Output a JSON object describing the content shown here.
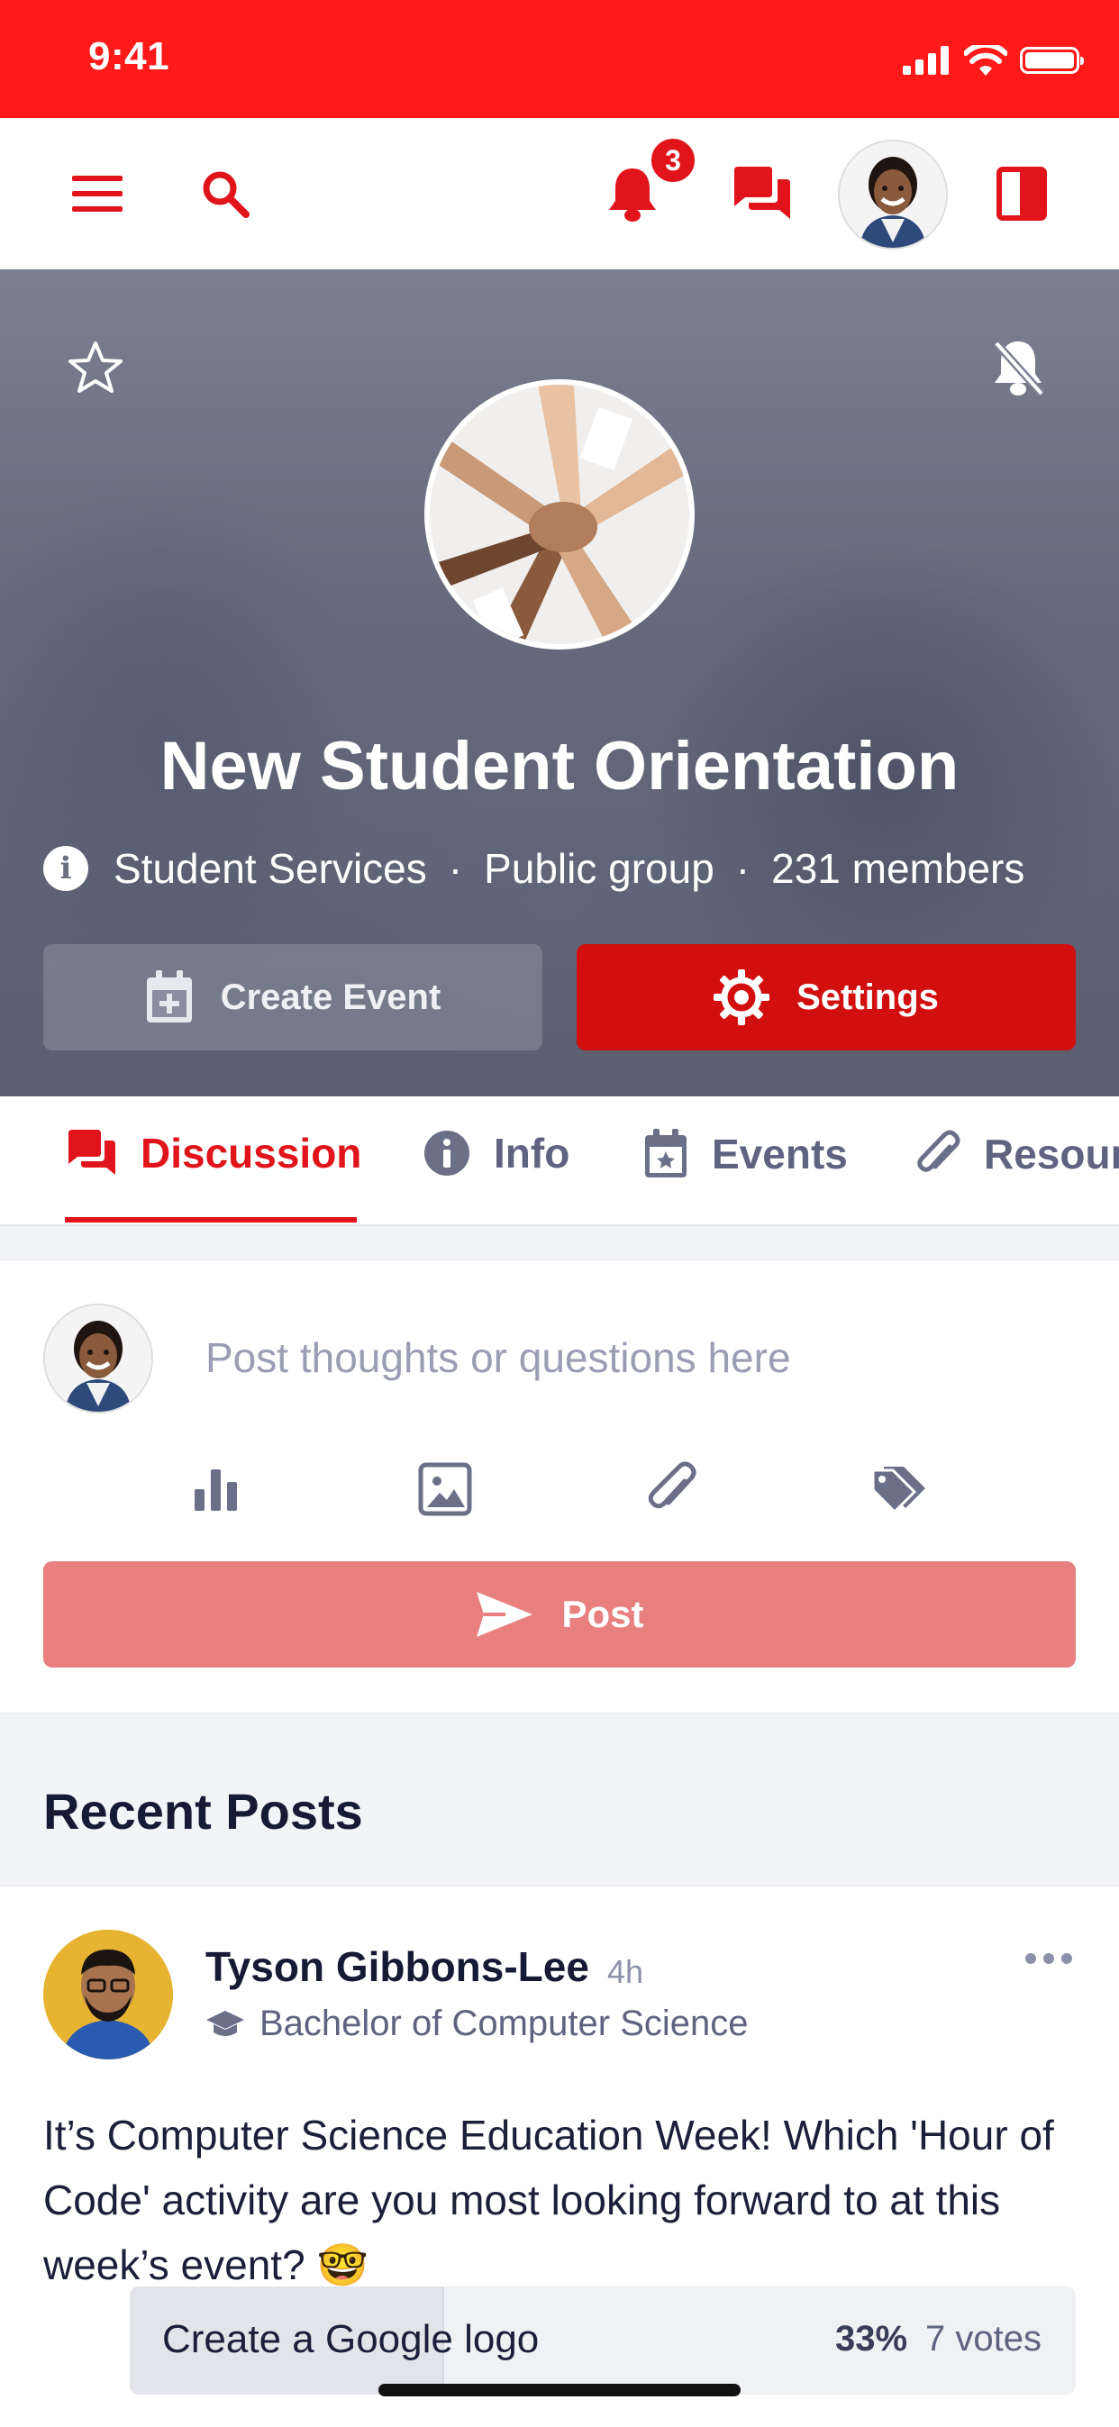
{
  "status_bar": {
    "time": "9:41"
  },
  "top_nav": {
    "notification_count": "3"
  },
  "group": {
    "name": "New Student Orientation",
    "department": "Student Services",
    "privacy": "Public group",
    "members": "231 members",
    "separator": "·",
    "info_glyph": "i"
  },
  "hero_actions": {
    "create_event": "Create Event",
    "settings": "Settings"
  },
  "tabs": [
    {
      "label": "Discussion",
      "icon": "chat-icon"
    },
    {
      "label": "Info",
      "icon": "info-icon"
    },
    {
      "label": "Events",
      "icon": "calendar-icon"
    },
    {
      "label": "Resources",
      "icon": "paperclip-icon"
    }
  ],
  "composer": {
    "placeholder": "Post thoughts or questions here",
    "tools": [
      "poll-icon",
      "image-icon",
      "attachment-icon",
      "tag-icon"
    ],
    "post_label": "Post"
  },
  "feed": {
    "section_title": "Recent Posts",
    "posts": [
      {
        "author": "Tyson Gibbons-Lee",
        "time": "4h",
        "program": "Bachelor of Computer Science",
        "text": "It’s Computer Science Education Week! Which 'Hour of Code' activity are you most looking forward to at this week’s event? 🤓",
        "poll": [
          {
            "label": "Create a Google logo",
            "percent_text": "33%",
            "percent": 33,
            "votes": "7 votes"
          }
        ]
      }
    ]
  },
  "colors": {
    "brand_red": "#ff1a1a",
    "accent_red": "#e0141a",
    "settings_red": "#d10f0f",
    "post_button": "#e88080",
    "muted_text": "#5f6380"
  }
}
